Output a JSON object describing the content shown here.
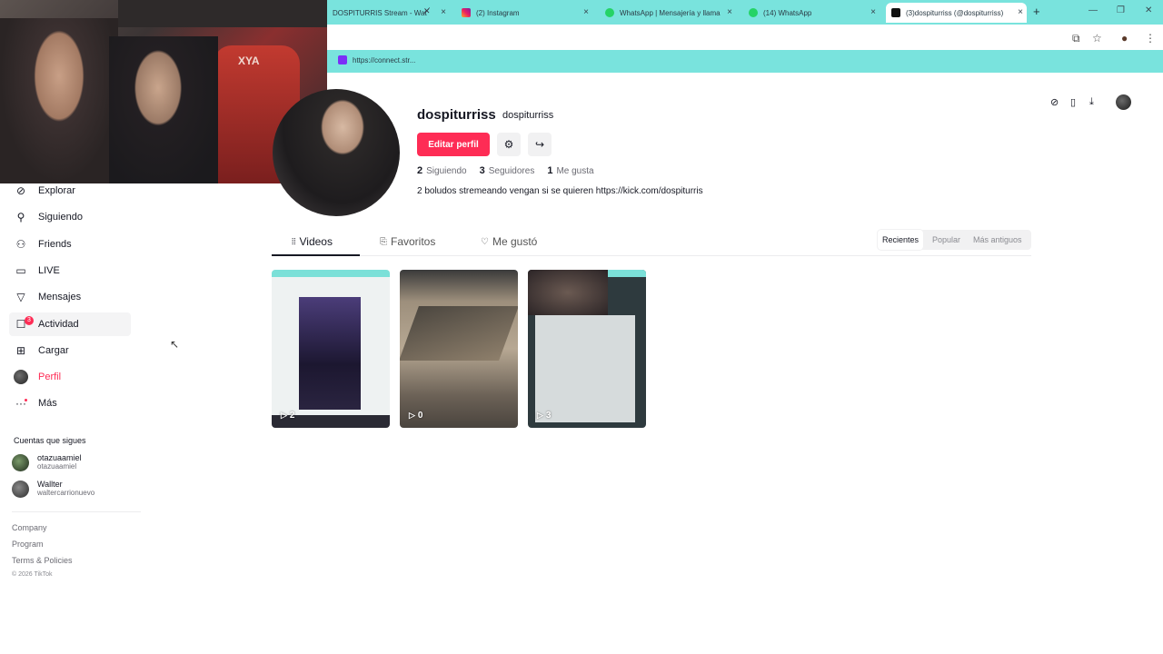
{
  "browser": {
    "tabs": [
      {
        "title": "DOSPITURRIS Stream - Wat",
        "active": false
      },
      {
        "title": "(2) Instagram",
        "active": false
      },
      {
        "title": "WhatsApp | Mensajería y llama",
        "active": false
      },
      {
        "title": "(14) WhatsApp",
        "active": false
      },
      {
        "title": "(3)dospiturriss (@dospiturriss)",
        "active": true
      }
    ],
    "bookmark": "https://connect.str..."
  },
  "sidebar": {
    "items": [
      {
        "label": "Explorar",
        "icon": "compass-icon"
      },
      {
        "label": "Siguiendo",
        "icon": "user-plus-icon"
      },
      {
        "label": "Friends",
        "icon": "friends-icon"
      },
      {
        "label": "LIVE",
        "icon": "live-icon"
      },
      {
        "label": "Mensajes",
        "icon": "send-icon"
      },
      {
        "label": "Actividad",
        "icon": "activity-icon",
        "badge": "3"
      },
      {
        "label": "Cargar",
        "icon": "upload-icon"
      },
      {
        "label": "Perfil",
        "icon": "avatar-icon"
      },
      {
        "label": "Más",
        "icon": "more-icon"
      }
    ],
    "following_title": "Cuentas que sigues",
    "following": [
      {
        "name": "otazuaamiel",
        "handle": "otazuaamiel"
      },
      {
        "name": "Wallter",
        "handle": "waltercarrionuevo"
      }
    ],
    "footer_links": [
      "Company",
      "Program",
      "Terms & Policies"
    ],
    "copyright": "© 2026 TikTok"
  },
  "profile": {
    "username": "dospiturriss",
    "nickname": "dospiturriss",
    "edit_button": "Editar perfil",
    "stats": [
      {
        "value": "2",
        "label": "Siguiendo"
      },
      {
        "value": "3",
        "label": "Seguidores"
      },
      {
        "value": "1",
        "label": "Me gusta"
      }
    ],
    "bio": "2 boludos stremeando vengan si se quieren https://kick.com/dospiturris"
  },
  "tabs": [
    {
      "label": "Videos",
      "icon": "grid-icon"
    },
    {
      "label": "Favoritos",
      "icon": "bookmark-icon"
    },
    {
      "label": "Me gustó",
      "icon": "heart-icon"
    }
  ],
  "sort": [
    "Recientes",
    "Popular",
    "Más antiguos"
  ],
  "videos": [
    {
      "views": "2"
    },
    {
      "views": "0"
    },
    {
      "views": "3"
    }
  ],
  "colors": {
    "accent": "#fe2c55",
    "browser_chrome": "#79e3dd"
  }
}
